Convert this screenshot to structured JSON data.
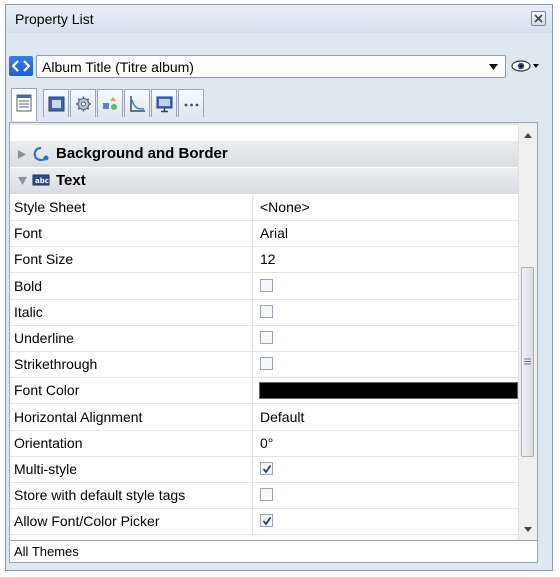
{
  "panel": {
    "title": "Property List",
    "object_selector": {
      "value": "Album Title (Titre album)"
    },
    "tabs": [
      {
        "icon": "property-list-icon",
        "active": true
      },
      {
        "icon": "object-box-icon"
      },
      {
        "icon": "gear-icon"
      },
      {
        "icon": "shapes-icon"
      },
      {
        "icon": "chart-axis-icon"
      },
      {
        "icon": "monitor-icon"
      },
      {
        "icon": "more-icon"
      }
    ],
    "sections": [
      {
        "label": "Background and Border",
        "expanded": false,
        "icon": "background-border-icon"
      },
      {
        "label": "Text",
        "expanded": true,
        "icon": "text-field-icon"
      }
    ],
    "properties": [
      {
        "name": "Style Sheet",
        "value": "<None>"
      },
      {
        "name": "Font",
        "value": "Arial"
      },
      {
        "name": "Font Size",
        "value": "12"
      },
      {
        "name": "Bold",
        "checked": false
      },
      {
        "name": "Italic",
        "checked": false
      },
      {
        "name": "Underline",
        "checked": false
      },
      {
        "name": "Strikethrough",
        "checked": false
      },
      {
        "name": "Font Color",
        "color": "#000000"
      },
      {
        "name": "Horizontal Alignment",
        "value": "Default"
      },
      {
        "name": "Orientation",
        "value": "0°"
      },
      {
        "name": "Multi-style",
        "checked": true
      },
      {
        "name": "Store with default style tags",
        "checked": false
      },
      {
        "name": "Allow Font/Color Picker",
        "checked": true
      }
    ],
    "status": "All Themes"
  }
}
